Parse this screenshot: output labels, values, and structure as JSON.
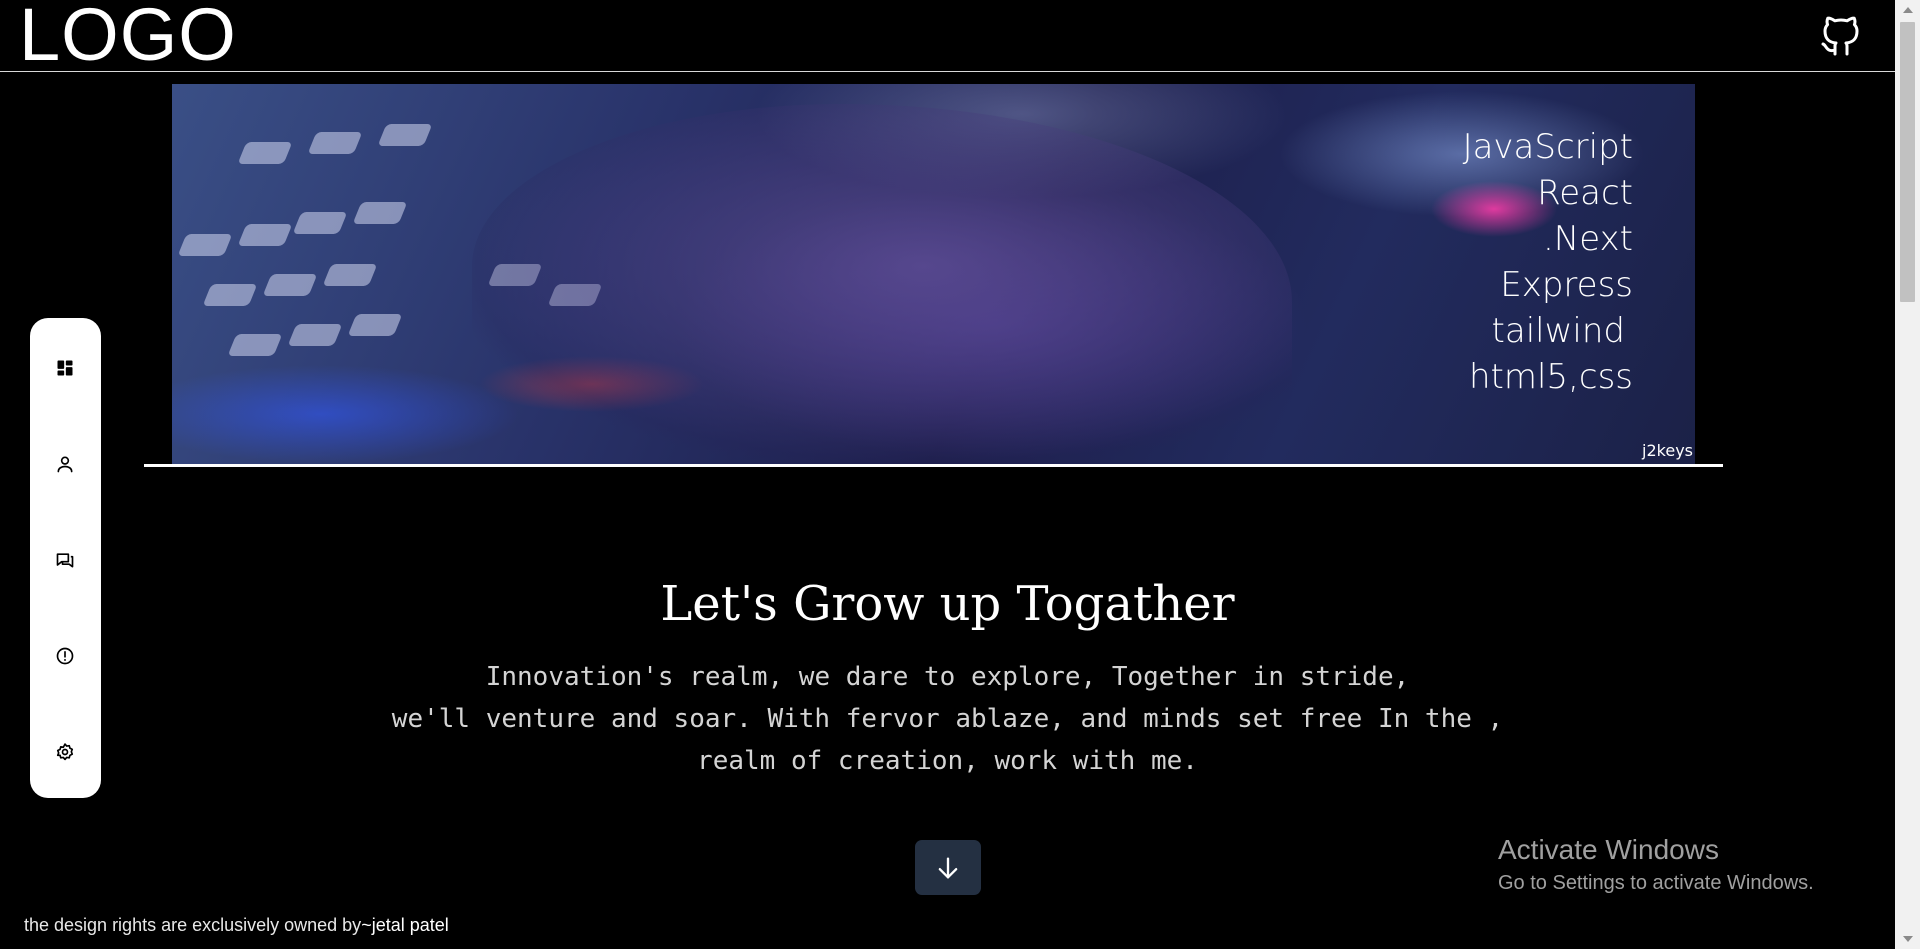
{
  "header": {
    "logo_text": "LOGO",
    "github_icon": "github-icon"
  },
  "hero": {
    "technologies": [
      "JavaScript",
      "React",
      ".Next",
      "Express",
      "tailwind",
      "html5,css"
    ],
    "credit": "j2keys"
  },
  "side_dock": {
    "items": [
      {
        "icon": "dashboard-icon"
      },
      {
        "icon": "user-icon"
      },
      {
        "icon": "chat-icon"
      },
      {
        "icon": "info-icon"
      },
      {
        "icon": "settings-icon"
      }
    ]
  },
  "main": {
    "title": "Let's Grow up Togather",
    "lines": [
      "Innovation's realm, we dare to explore, Together in stride,",
      "we'll venture and soar. With fervor ablaze, and minds set free In the ,",
      "realm of creation, work with me."
    ],
    "scroll_button_icon": "arrow-down-icon"
  },
  "watermark": {
    "title": "Activate Windows",
    "subtitle": "Go to Settings to activate Windows."
  },
  "footer": {
    "text": "the design rights are exclusively owned by",
    "owner": "~jetal patel"
  },
  "colors": {
    "background": "#000000",
    "dock": "#ffffff",
    "scroll_button": "#243042"
  }
}
